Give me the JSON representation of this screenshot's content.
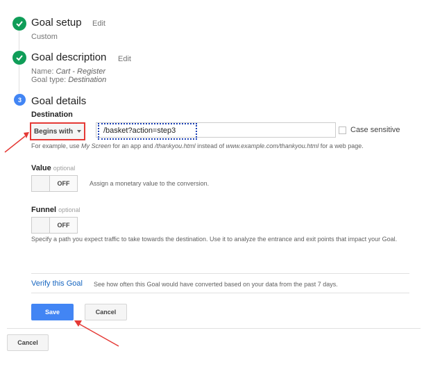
{
  "steps": {
    "setup": {
      "title": "Goal setup",
      "edit": "Edit",
      "sub": "Custom"
    },
    "description": {
      "title": "Goal description",
      "edit": "Edit",
      "name_prefix": "Name: ",
      "name_value": "Cart - Register",
      "type_prefix": "Goal type: ",
      "type_value": "Destination"
    },
    "details": {
      "number": "3",
      "title": "Goal details"
    }
  },
  "destination": {
    "label": "Destination",
    "match_type": "Begins with",
    "value": "/basket?action=step3",
    "case_sensitive_label": "Case sensitive",
    "hint": {
      "p1": "For example, use ",
      "e1": "My Screen",
      "p2": " for an app and ",
      "e2": "/thankyou.html",
      "p3": " instead of ",
      "e3": "www.example.com/thankyou.html",
      "p4": " for a web page."
    }
  },
  "value_section": {
    "label": "Value",
    "optional": "optional",
    "toggle": "OFF",
    "description": "Assign a monetary value to the conversion."
  },
  "funnel_section": {
    "label": "Funnel",
    "optional": "optional",
    "toggle": "OFF",
    "description": "Specify a path you expect traffic to take towards the destination. Use it to analyze the entrance and exit points that impact your Goal."
  },
  "verify": {
    "link": "Verify this Goal",
    "description": "See how often this Goal would have converted based on your data from the past 7 days."
  },
  "buttons": {
    "save": "Save",
    "cancel": "Cancel",
    "outer_cancel": "Cancel"
  },
  "colors": {
    "check_green": "#0f9d58",
    "step_blue": "#4285f4",
    "save_blue": "#4285f4",
    "highlight_red": "#e53935",
    "dotted_blue": "#1a3fb5",
    "link_blue": "#1565c0"
  },
  "icons": {
    "setup": "check-circle-icon",
    "description": "check-circle-icon",
    "dropdown": "chevron-down-icon"
  }
}
